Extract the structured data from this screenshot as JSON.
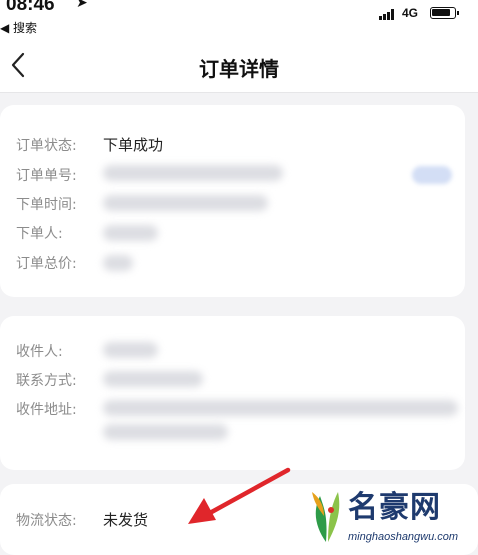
{
  "status_bar": {
    "time": "08:46",
    "back_app": "◀ 搜索",
    "network": "4G"
  },
  "nav": {
    "title": "订单详情"
  },
  "order_info": {
    "rows": [
      {
        "label": "订单状态:",
        "value": "下单成功"
      },
      {
        "label": "订单单号:",
        "value": ""
      },
      {
        "label": "下单时间:",
        "value": ""
      },
      {
        "label": "下单人:",
        "value": ""
      },
      {
        "label": "订单总价:",
        "value": ""
      }
    ]
  },
  "receiver_info": {
    "rows": [
      {
        "label": "收件人:",
        "value": ""
      },
      {
        "label": "联系方式:",
        "value": ""
      },
      {
        "label": "收件地址:",
        "value": ""
      }
    ]
  },
  "shipping": {
    "label": "物流状态:",
    "value": "未发货"
  },
  "watermark": {
    "brand": "名豪网",
    "url": "minghaoshangwu.com"
  },
  "colors": {
    "arrow": "#e0262b",
    "label": "#8c8c8c",
    "watermark": "#1e3a6e"
  },
  "icons": {
    "nav_back": "chevron-left-icon",
    "battery": "battery-icon",
    "signal": "signal-icon",
    "annotation_arrow": "red-arrow-icon",
    "watermark_logo": "leaf-logo-icon"
  }
}
